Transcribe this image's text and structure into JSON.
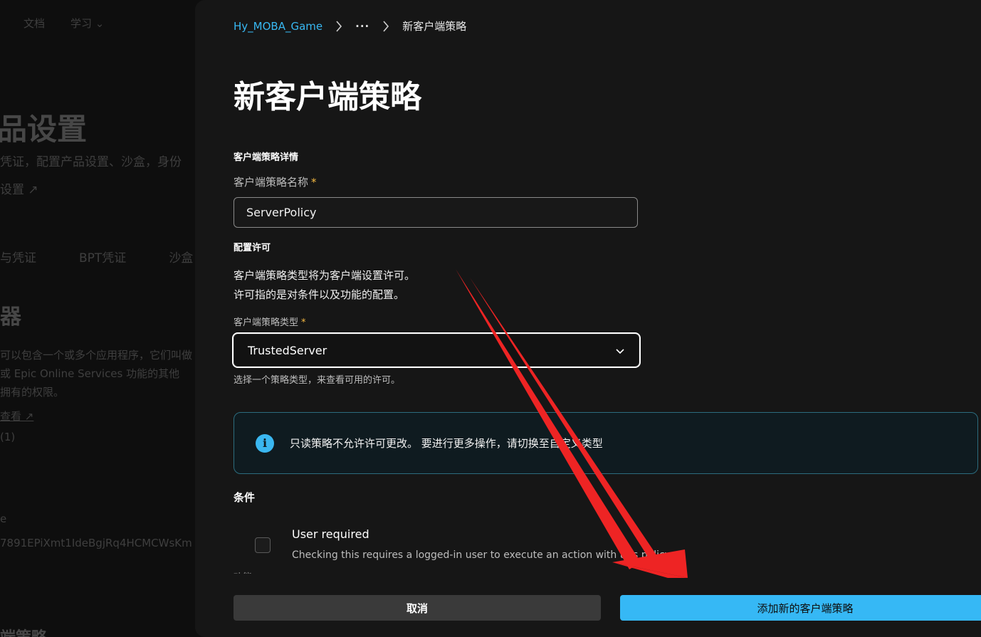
{
  "background": {
    "nav": [
      "文档",
      "学习 ⌄"
    ],
    "heading": "品设置",
    "subtitle": "凭证，配置产品设置、沙盒，身份",
    "link": "设置 ↗",
    "tabs": [
      "与凭证",
      "BPT凭证",
      "沙盒"
    ],
    "section_heading": "器",
    "para_lines": [
      "可以包含一个或多个应用程序，它们叫做",
      "或 Epic Online Services 功能的其他",
      "拥有的权限。"
    ],
    "link2": "查看 ↗",
    "count": "(1)",
    "e": "e",
    "id": "7891EPiXmt1IdeBgjRq4HCMCWsKm",
    "footer_heading": "端策略"
  },
  "breadcrumb": {
    "root": "Hy_MOBA_Game",
    "more": "···",
    "current": "新客户端策略"
  },
  "title": "新客户端策略",
  "details": {
    "section_label": "客户端策略详情",
    "name_label": "客户端策略名称",
    "required_mark": "*",
    "name_value": "ServerPolicy"
  },
  "permissions": {
    "section_label": "配置许可",
    "desc_line1": "客户端策略类型将为客户端设置许可。",
    "desc_line2": "许可指的是对条件以及功能的配置。",
    "type_label": "客户端策略类型",
    "type_value": "TrustedServer",
    "helper": "选择一个策略类型，来查看可用的许可。"
  },
  "alert": {
    "icon": "info-icon",
    "icon_glyph": "i",
    "text": "只读策略不允许许可更改。 要进行更多操作，请切换至自定义类型"
  },
  "conditions": {
    "title": "条件",
    "user_required_title": "User required",
    "user_required_desc": "Checking this requires a logged-in user to execute an action with this policy.",
    "cut_off_text": "功能"
  },
  "footer": {
    "cancel_label": "取消",
    "add_label": "添加新的客户端策略"
  },
  "colors": {
    "accent": "#36b8f5",
    "link": "#38b8f2",
    "required": "#f5b942",
    "annotation": "#ee2424"
  }
}
